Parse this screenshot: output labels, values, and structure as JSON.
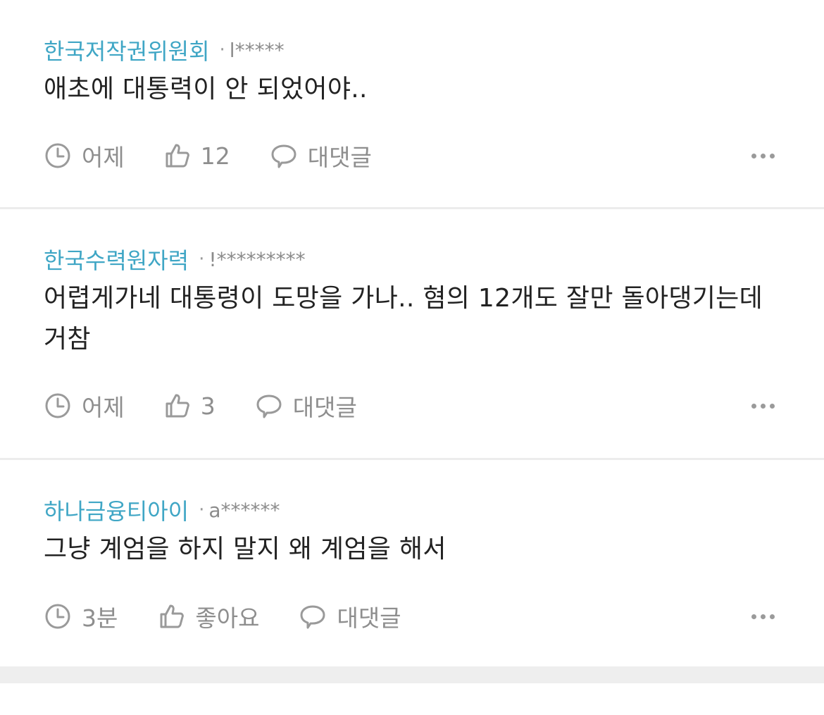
{
  "comments": [
    {
      "org": "한국저작권위원회",
      "separator": "·",
      "user": "l*****",
      "text": "애초에 대통력이 안 되었어야..",
      "time": "어제",
      "likes": "12",
      "reply_label": "대댓글"
    },
    {
      "org": "한국수력원자력",
      "separator": "·",
      "user": "!*********",
      "text": "어렵게가네 대통령이 도망을 가나.. 혐의 12개도 잘만 돌아댕기는데 거참",
      "time": "어제",
      "likes": "3",
      "reply_label": "대댓글"
    },
    {
      "org": "하나금융티아이",
      "separator": "·",
      "user": "a******",
      "text": "그냥 계엄을 하지 말지 왜 계엄을 해서",
      "time": "3분",
      "likes": "좋아요",
      "reply_label": "대댓글"
    }
  ],
  "icons": {
    "time": "clock-icon",
    "like": "thumbs-up-icon",
    "reply": "speech-bubble-icon",
    "more": "more-dots-icon"
  },
  "colors": {
    "org_name": "#3fa6c5",
    "body_text": "#222222",
    "meta_text": "#8e8e8e",
    "divider": "#ececec"
  }
}
